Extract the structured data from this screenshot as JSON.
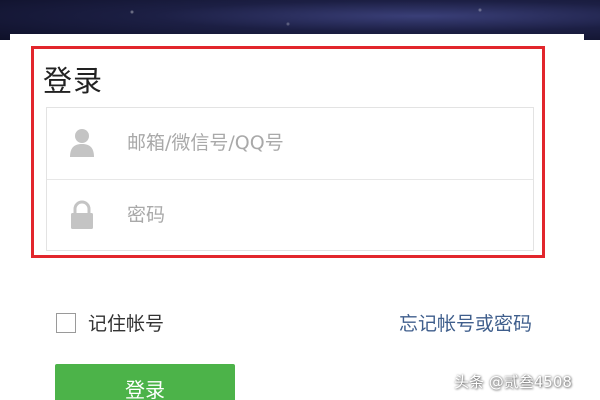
{
  "login": {
    "title": "登录",
    "account_placeholder": "邮箱/微信号/QQ号",
    "password_placeholder": "密码",
    "remember_label": "记住帐号",
    "forgot_link": "忘记帐号或密码",
    "submit_label": "登录"
  },
  "icons": {
    "account": "user-icon",
    "password": "lock-icon"
  },
  "colors": {
    "highlight_border": "#e2262c",
    "button_green": "#4cb349",
    "link_blue": "#3f5e8c"
  },
  "watermark": {
    "text": "头条 @贰叁4508"
  }
}
